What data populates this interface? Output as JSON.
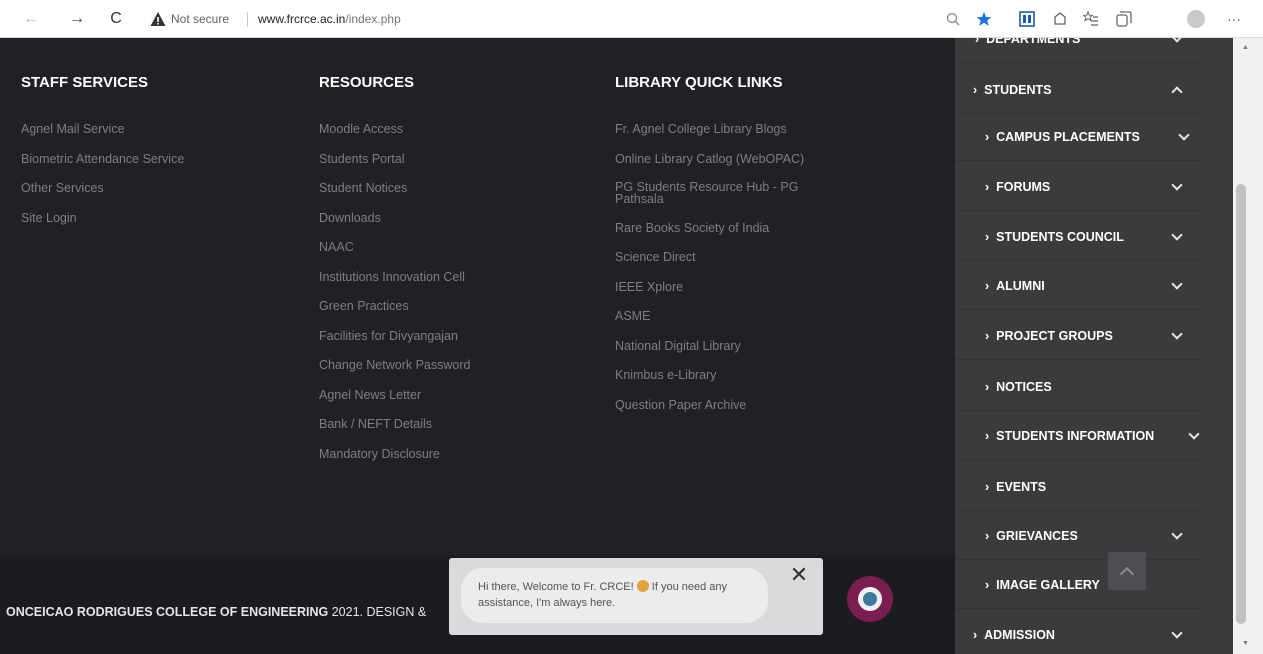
{
  "browser": {
    "back_glyph": "←",
    "forward_glyph": "→",
    "reload_glyph": "C",
    "security_label": "Not secure",
    "url_domain": "www.frcrce.ac.in",
    "url_path": "/index.php",
    "more_glyph": "···"
  },
  "footer": {
    "staff_services": {
      "heading": "STAFF SERVICES",
      "links": [
        "Agnel Mail Service",
        "Biometric Attendance Service",
        "Other Services",
        "Site Login"
      ]
    },
    "resources": {
      "heading": "RESOURCES",
      "links": [
        "Moodle Access",
        "Students Portal",
        "Student Notices",
        "Downloads",
        "NAAC",
        "Institutions Innovation Cell",
        "Green Practices",
        "Facilities for Divyangajan",
        "Change Network Password",
        "Agnel News Letter",
        "Bank / NEFT Details",
        "Mandatory Disclosure"
      ]
    },
    "library": {
      "heading": "LIBRARY QUICK LINKS",
      "links": [
        "Fr. Agnel College Library Blogs",
        "Online Library Catlog (WebOPAC)",
        "PG Students Resource Hub - PG Pathsala",
        "Rare Books Society of India",
        "Science Direct",
        "IEEE Xplore",
        "ASME",
        "National Digital Library",
        "Knimbus e-Library",
        "Question Paper Archive"
      ]
    },
    "copyright_bold": "ONCEICAO RODRIGUES COLLEGE OF ENGINEERING",
    "copyright_rest": " 2021. DESIGN &"
  },
  "chat": {
    "message_part1": "Hi there, Welcome to Fr. CRCE!",
    "message_part2": " If you need any assistance, I'm always here.",
    "close_glyph": "✕"
  },
  "sidebar": {
    "items": [
      {
        "label": "DEPARTMENTS",
        "chevron": "down"
      },
      {
        "label": "STUDENTS",
        "chevron": "up"
      },
      {
        "label": "CAMPUS PLACEMENTS",
        "chevron": "down"
      },
      {
        "label": "FORUMS",
        "chevron": "down"
      },
      {
        "label": "STUDENTS COUNCIL",
        "chevron": "down"
      },
      {
        "label": "ALUMNI",
        "chevron": "down"
      },
      {
        "label": "PROJECT GROUPS",
        "chevron": "down"
      },
      {
        "label": "NOTICES",
        "chevron": ""
      },
      {
        "label": "STUDENTS INFORMATION",
        "chevron": "down"
      },
      {
        "label": "EVENTS",
        "chevron": ""
      },
      {
        "label": "GRIEVANCES",
        "chevron": "down"
      },
      {
        "label": "IMAGE GALLERY",
        "chevron": ""
      },
      {
        "label": "ADMISSION",
        "chevron": "down"
      }
    ]
  },
  "colors": {
    "footer_bg": "#1f2124",
    "sidebar_bg": "#3a3b3d",
    "chat_launcher": "#7a1d52",
    "link_text": "#7d7f82",
    "heading_text": "#ffffff"
  }
}
